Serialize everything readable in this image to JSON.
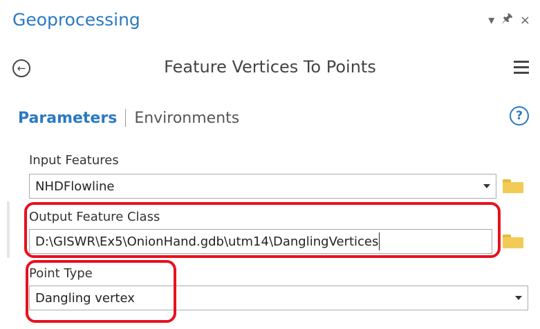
{
  "pane": {
    "title": "Geoprocessing",
    "pin_glyph": "↓'",
    "close_glyph": "×",
    "pin_icon": "pin-icon",
    "autohide_icon": "dropdown-pin-icon"
  },
  "tool": {
    "title": "Feature Vertices To Points",
    "back_glyph": "←"
  },
  "tabs": {
    "parameters": "Parameters",
    "environments": "Environments",
    "help_glyph": "?"
  },
  "params": {
    "input_features": {
      "label": "Input Features",
      "value": "NHDFlowline"
    },
    "output_feature_class": {
      "label": "Output Feature Class",
      "value": "D:\\GISWR\\Ex5\\OnionHand.gdb\\utm14\\DanglingVertices"
    },
    "point_type": {
      "label": "Point Type",
      "value": "Dangling vertex"
    }
  },
  "colors": {
    "accent": "#2b79c2",
    "highlight": "#e8101e",
    "folder": "#f1cb55"
  }
}
